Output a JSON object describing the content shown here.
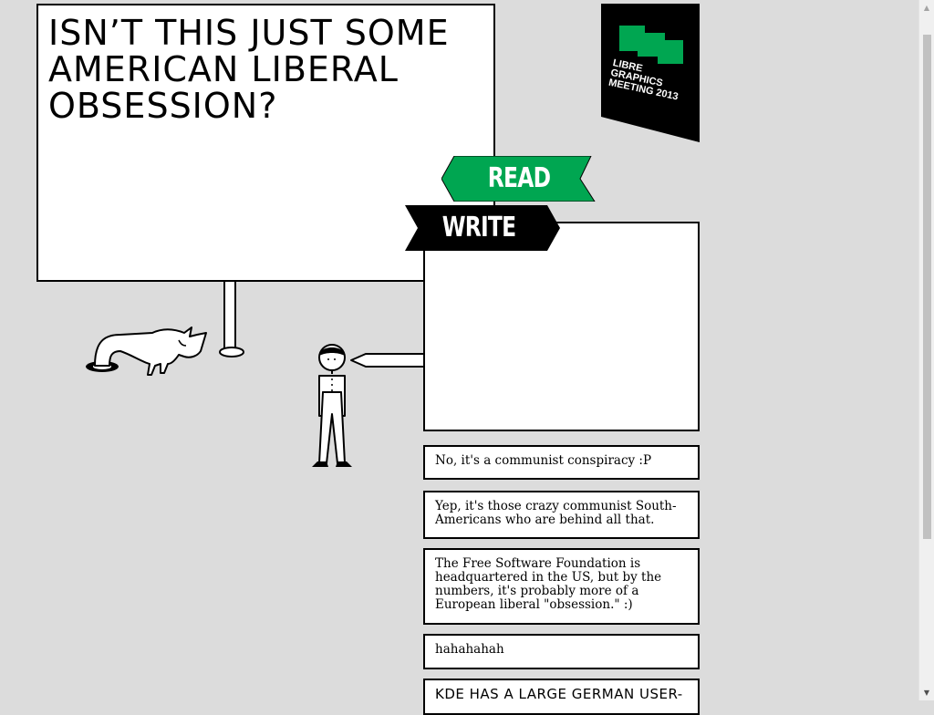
{
  "question": {
    "title": "Isn’t this just some American liberal obsession?"
  },
  "banner": {
    "line1": "Libre Graphics",
    "line2": "Meeting 2013",
    "accent": "#00a651"
  },
  "tabs": {
    "read_label": "READ",
    "write_label": "WRITE",
    "read_color": "#00a651",
    "write_color": "#000000"
  },
  "write_box": {
    "value": "",
    "placeholder": ""
  },
  "answers": [
    {
      "text": "No, it's a communist conspiracy :P"
    },
    {
      "text": "Yep, it's those crazy communist South-Americans who are behind all that."
    },
    {
      "text": "The Free Software Foundation is headquartered in the US, but by the numbers, it's probably more of a European liberal \"obsession.\" :)"
    },
    {
      "text": "hahahahah"
    },
    {
      "text": "KDE has a large German user-"
    }
  ]
}
